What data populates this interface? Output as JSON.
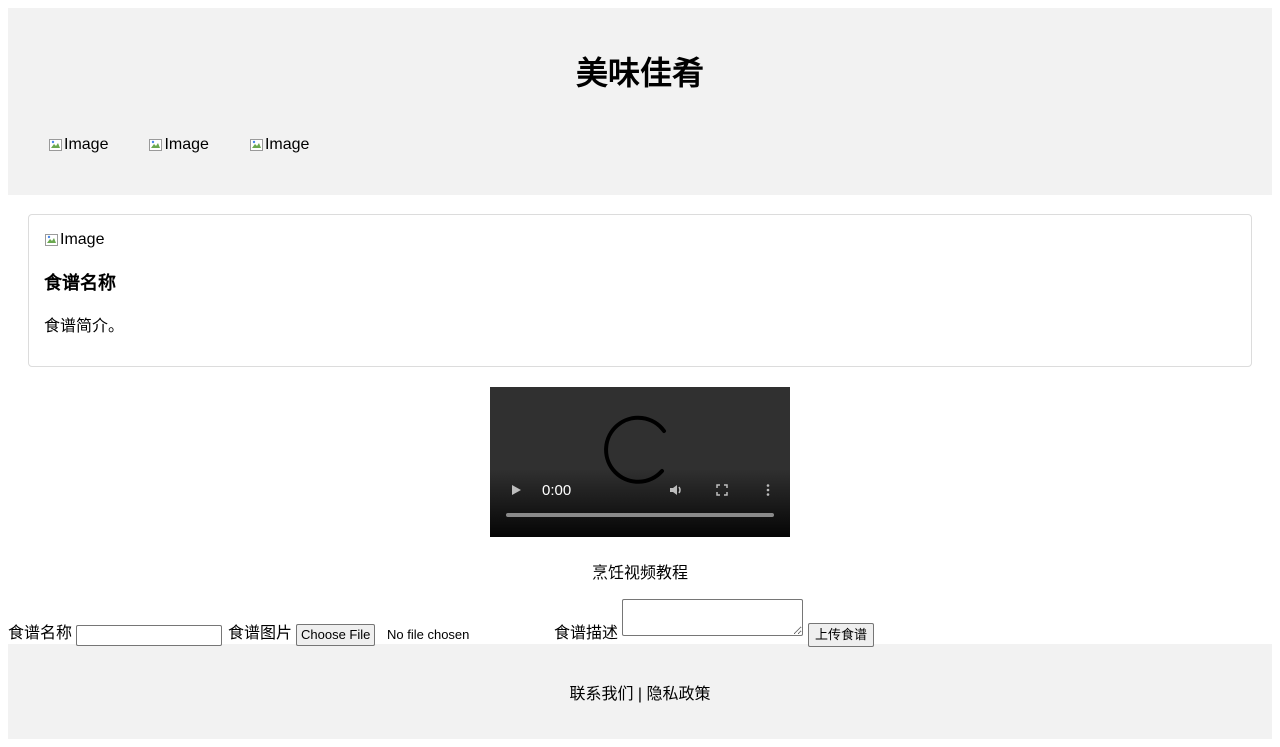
{
  "header": {
    "title": "美味佳肴",
    "nav_images": [
      {
        "alt": "Image"
      },
      {
        "alt": "Image"
      },
      {
        "alt": "Image"
      }
    ]
  },
  "recipe_card": {
    "image_alt": "Image",
    "title": "食谱名称",
    "description": "食谱简介。"
  },
  "video": {
    "time": "0:00",
    "caption": "烹饪视频教程",
    "progress": 0
  },
  "upload_form": {
    "name_label": "食谱名称",
    "name_value": "",
    "image_label": "食谱图片",
    "file_button": "Choose File",
    "file_status": "No file chosen",
    "desc_label": "食谱描述",
    "desc_value": "",
    "submit_label": "上传食谱"
  },
  "footer": {
    "text": "联系我们 | 隐私政策"
  },
  "colors": {
    "header_bg": "#f2f2f2",
    "footer_bg": "#f2f2f2",
    "card_border": "#dcdcdc"
  }
}
